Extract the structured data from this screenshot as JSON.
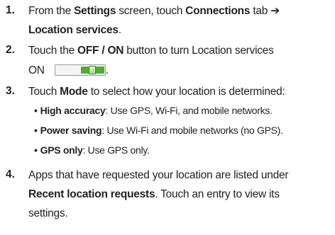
{
  "steps": [
    {
      "number": "1.",
      "lines": [
        [
          "From the ",
          "Settings",
          " screen, touch ",
          "Connections",
          " tab ",
          "➔"
        ],
        [
          "Location services",
          "."
        ]
      ]
    },
    {
      "number": "2.",
      "lines": [
        [
          "Touch the ",
          "OFF / ON",
          " button to turn Location services"
        ],
        [
          "ON",
          "."
        ]
      ],
      "toggle_state": "on",
      "toggle_color": "#4caf2e"
    },
    {
      "number": "3.",
      "lines": [
        [
          "Touch ",
          "Mode",
          " to select how your location is determined:"
        ]
      ],
      "bullets": [
        {
          "bullet": "•",
          "term": "High accuracy",
          "text": ": Use GPS, Wi-Fi, and mobile networks."
        },
        {
          "bullet": "•",
          "term": "Power saving",
          "text": ": Use Wi-Fi and mobile networks (no GPS)."
        },
        {
          "bullet": "•",
          "term": "GPS only",
          "text": ": Use GPS only."
        }
      ]
    },
    {
      "number": "4.",
      "lines": [
        [
          "Apps that have requested your location are listed under"
        ],
        [
          "Recent location requests",
          ". Touch an entry to view its"
        ],
        [
          "settings."
        ]
      ]
    }
  ]
}
